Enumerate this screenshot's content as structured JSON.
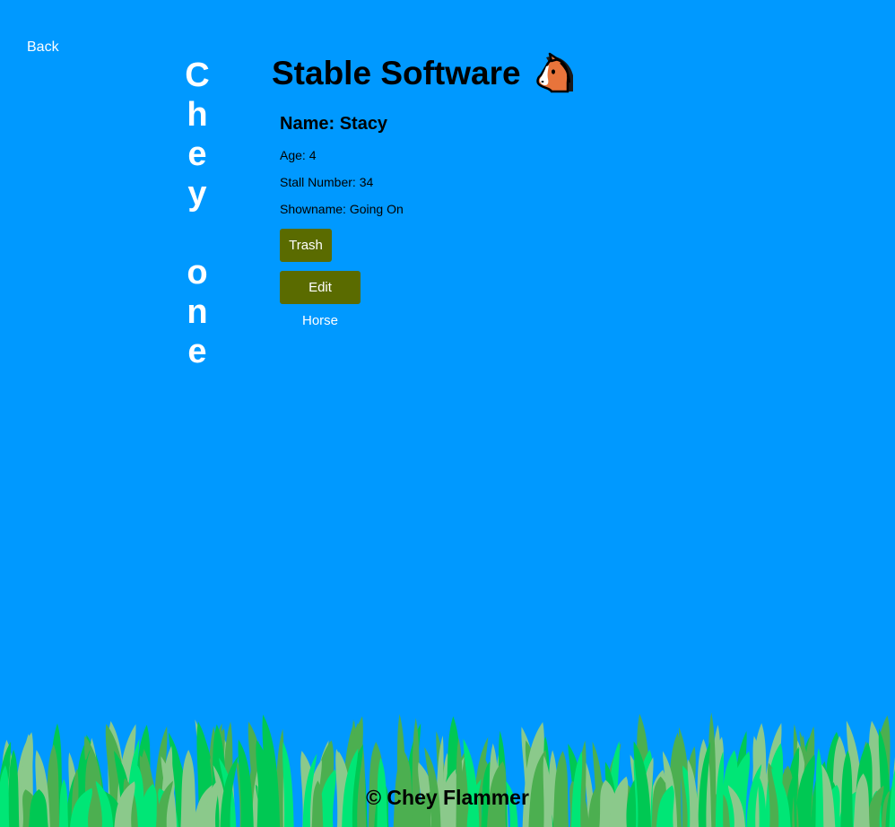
{
  "nav": {
    "back_label": "Back"
  },
  "sidebar": {
    "letters": [
      "C",
      "h",
      "e",
      "y",
      "",
      "o",
      "n",
      "e"
    ]
  },
  "header": {
    "title": "Stable Software",
    "icon": "horse-face-icon"
  },
  "horse": {
    "name_label": "Name: Stacy",
    "age_label": "Age: 4",
    "stall_label": "Stall Number: 34",
    "showname_label": "Showname: Going On"
  },
  "actions": {
    "trash_label": "Trash",
    "edit_label": "Edit Horse"
  },
  "footer": {
    "text": "© Chey Flammer"
  },
  "colors": {
    "background": "#0099ff",
    "button": "#5a6b00",
    "grass_light": "#00e676",
    "grass_mid": "#4caf50",
    "grass_pale": "#8bc98b"
  }
}
